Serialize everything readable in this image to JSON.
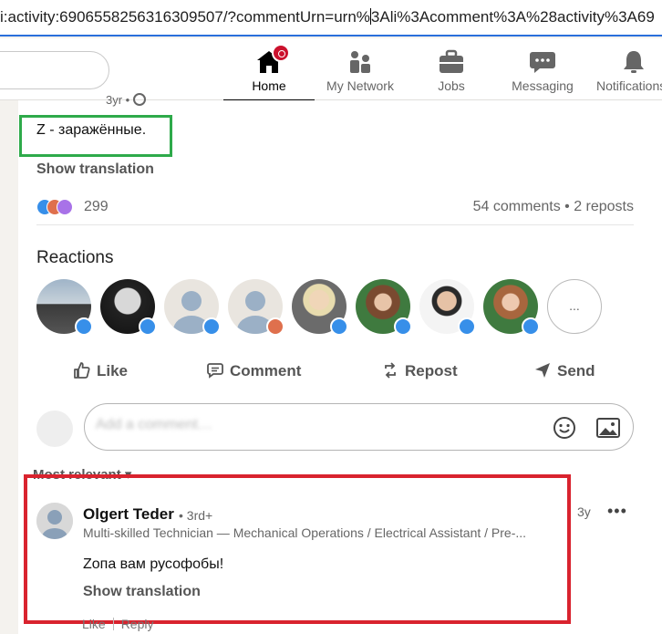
{
  "browser": {
    "url_left": "i:activity:6906558256316309507/?commentUrn=urn%",
    "url_right": "3Ali%3Acomment%3A%28activity%3A69"
  },
  "nav": {
    "items": [
      {
        "label": "Home",
        "icon": "home-icon"
      },
      {
        "label": "My Network",
        "icon": "network-icon"
      },
      {
        "label": "Jobs",
        "icon": "briefcase-icon"
      },
      {
        "label": "Messaging",
        "icon": "messaging-icon"
      },
      {
        "label": "Notifications",
        "icon": "bell-icon"
      }
    ]
  },
  "post": {
    "time": "3yr •",
    "text": "Z - заражённые.",
    "show_translation": "Show translation",
    "reactions_count": "299",
    "comments_reposts": "54 comments • 2 reposts",
    "reactions_title": "Reactions",
    "more_label": "...",
    "actions": {
      "like": "Like",
      "comment": "Comment",
      "repost": "Repost",
      "send": "Send"
    },
    "composer_placeholder": "Add a comment…",
    "sort_label": "Most relevant ▾"
  },
  "comment": {
    "author": "Olgert Teder",
    "degree": "• 3rd+",
    "headline": "Multi-skilled Technician — Mechanical Operations / Electrical Assistant / Pre-...",
    "time": "3y",
    "more": "•••",
    "text": "Zопа вам русофобы!",
    "show_translation": "Show translation",
    "like": "Like",
    "reply": "Reply"
  },
  "colors": {
    "accent_blue": "#378fe9",
    "highlight_green": "#2eaa4a",
    "highlight_red": "#d9232e",
    "badge_red": "#cb112d"
  }
}
